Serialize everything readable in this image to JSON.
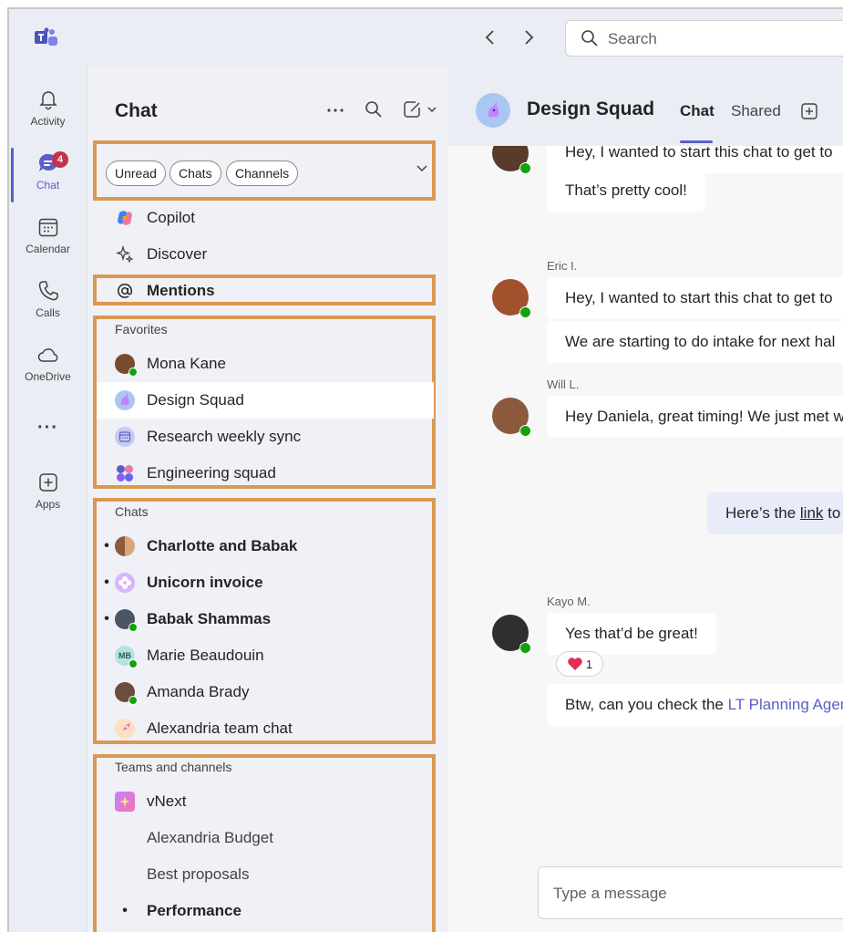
{
  "titlebar": {
    "search_placeholder": "Search",
    "back_label": "‹",
    "forward_label": "›"
  },
  "rail": {
    "items": [
      {
        "label": "Activity",
        "icon": "bell-icon"
      },
      {
        "label": "Chat",
        "icon": "chat-icon",
        "badge": "4"
      },
      {
        "label": "Calendar",
        "icon": "calendar-icon"
      },
      {
        "label": "Calls",
        "icon": "phone-icon"
      },
      {
        "label": "OneDrive",
        "icon": "cloud-icon"
      },
      {
        "label": "···",
        "icon": "more-icon"
      },
      {
        "label": "Apps",
        "icon": "plus-box-icon"
      }
    ]
  },
  "panel": {
    "title": "Chat",
    "filters": [
      "Unread",
      "Chats",
      "Channels"
    ],
    "nav": {
      "copilot": "Copilot",
      "discover": "Discover",
      "mentions": "Mentions"
    },
    "favorites": {
      "label": "Favorites",
      "items": [
        "Mona Kane",
        "Design Squad",
        "Research weekly sync",
        "Engineering squad"
      ]
    },
    "chats": {
      "label": "Chats",
      "items": [
        "Charlotte and Babak",
        "Unicorn invoice",
        "Babak Shammas",
        "Marie Beaudouin",
        "Amanda Brady",
        "Alexandria team chat"
      ],
      "marie_initials": "MB"
    },
    "teams": {
      "label": "Teams and channels",
      "items": [
        "vNext",
        "Alexandria Budget",
        "Best proposals",
        "Performance"
      ]
    }
  },
  "main": {
    "group_name": "Design Squad",
    "tabs": [
      "Chat",
      "Shared"
    ],
    "messages": {
      "m1": "Hey, I wanted to start this chat to get to",
      "m2": "That’s pretty cool!",
      "eric_name": "Eric I.",
      "m3": "Hey, I wanted to start this chat to get to",
      "m4": "We are starting to do intake for next hal",
      "will_name": "Will L.",
      "m5": "Hey Daniela, great timing! We just met w",
      "self_prefix": "Here’s the ",
      "self_link": "link",
      "self_suffix": " to",
      "kayo_name": "Kayo M.",
      "m6": "Yes that’d be great!",
      "reaction_count": "1",
      "m7_prefix": "Btw, can you check the ",
      "m7_link": "LT Planning Agen"
    },
    "compose_placeholder": "Type a message"
  },
  "colors": {
    "accent": "#5b5fc7",
    "highlight_box": "#d99952",
    "badge": "#c4314b",
    "presence": "#13a10e"
  }
}
